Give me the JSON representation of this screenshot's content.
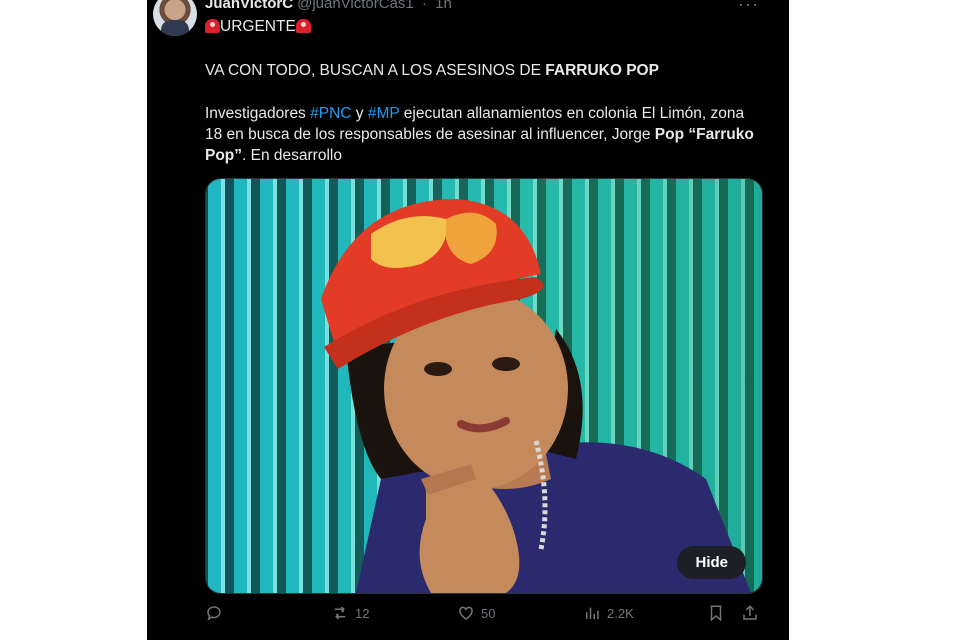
{
  "header": {
    "display_name": "JuanVictorC",
    "handle": "@juanVictorCas1",
    "separator": "·",
    "time": "1h",
    "more": "···"
  },
  "tweet": {
    "urgent_label": "URGENTE",
    "line1_prefix": "VA CON TODO, BUSCAN A LOS ASESINOS DE ",
    "line1_bold": "FARRUKO POP",
    "p2_a": "Investigadores ",
    "p2_hashtag1": "#PNC",
    "p2_b": " y ",
    "p2_hashtag2": "#MP",
    "p2_c": " ejecutan allanamientos en colonia El Limón, zona 18 en busca de los responsables de asesinar al influencer, Jorge ",
    "p2_bold1": "Pop",
    "p2_d": " ",
    "p2_bold2": "“Farruko Pop”",
    "p2_e": ". En desarrollo"
  },
  "media": {
    "hide_label": "Hide"
  },
  "actions": {
    "reply_count": "",
    "retweet_count": "12",
    "like_count": "50",
    "views_count": "2.2K"
  },
  "icons": [
    "reply-icon",
    "retweet-icon",
    "like-icon",
    "views-icon",
    "bookmark-icon",
    "share-icon",
    "siren-icon"
  ],
  "colors": {
    "background": "#000000",
    "text": "#e7e9ea",
    "muted": "#71767b",
    "link": "#1d9bf0"
  }
}
